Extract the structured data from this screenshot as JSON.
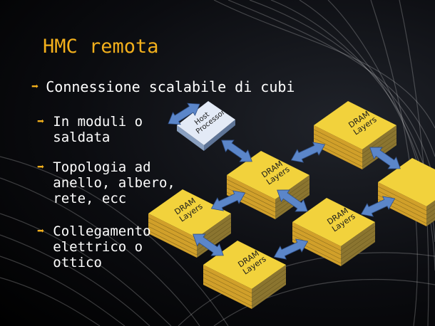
{
  "slide": {
    "title": "HMC remota",
    "bullets": [
      {
        "text": "Connessione scalabile di cubi",
        "level": 1
      },
      {
        "text": "In moduli o\nsaldata",
        "level": 2
      },
      {
        "text": "Topologia ad\nanello, albero,\nrete, ecc",
        "level": 2
      },
      {
        "text": "Collegamento\nelettrico o\nottico",
        "level": 2
      }
    ]
  },
  "diagram": {
    "host_processor": {
      "line1": "Host",
      "line2": "Processor"
    },
    "dram_cube": {
      "line1": "DRAM",
      "line2": "Layers"
    }
  },
  "colors": {
    "title": "#f3b01c",
    "bullet_arrow": "#f3b01c",
    "text": "#ffffff",
    "cube_top": "#f2d23c",
    "cube_side": "#7a6a2c",
    "link_arrow": "#5b86c9",
    "host_top": "#e3eaf6"
  }
}
